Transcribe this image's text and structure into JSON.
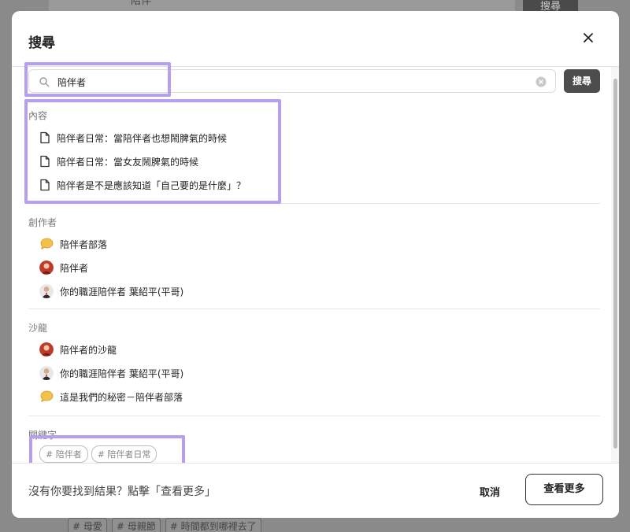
{
  "background": {
    "search_text": "陪伴",
    "search_button": "搜尋",
    "tags": [
      "# 母愛",
      "# 母親節",
      "# 時間都到哪裡去了"
    ]
  },
  "modal": {
    "title": "搜尋",
    "search": {
      "value": "陪伴者",
      "button_label": "搜尋"
    },
    "sections": {
      "content": {
        "heading": "內容",
        "items": [
          "陪伴者日常：當陪伴者也想鬧脾氣的時候",
          "陪伴者日常：當女友鬧脾氣的時候",
          "陪伴者是不是應該知道「自己要的是什麼」？"
        ]
      },
      "creators": {
        "heading": "創作者",
        "items": [
          {
            "label": "陪伴者部落",
            "avatar": "yellow-speech-bubble"
          },
          {
            "label": "陪伴者",
            "avatar": "red-portrait"
          },
          {
            "label": "你的職涯陪伴者 葉紹平(平哥)",
            "avatar": "man-in-suit"
          }
        ]
      },
      "salons": {
        "heading": "沙龍",
        "items": [
          {
            "label": "陪伴者的沙龍",
            "avatar": "red-portrait"
          },
          {
            "label": "你的職涯陪伴者 葉紹平(平哥)",
            "avatar": "man-in-suit"
          },
          {
            "label": "這是我們的秘密－陪伴者部落",
            "avatar": "yellow-speech-bubble"
          }
        ]
      },
      "keywords": {
        "heading": "關鍵字",
        "tags": [
          "# 陪伴者",
          "# 陪伴者日常"
        ]
      }
    },
    "footer": {
      "hint": "沒有你要找到結果？點擊「查看更多」",
      "cancel_label": "取消",
      "more_label": "查看更多"
    }
  },
  "colors": {
    "highlight": "#b69ef2",
    "button_dark": "#4d4d4d"
  }
}
